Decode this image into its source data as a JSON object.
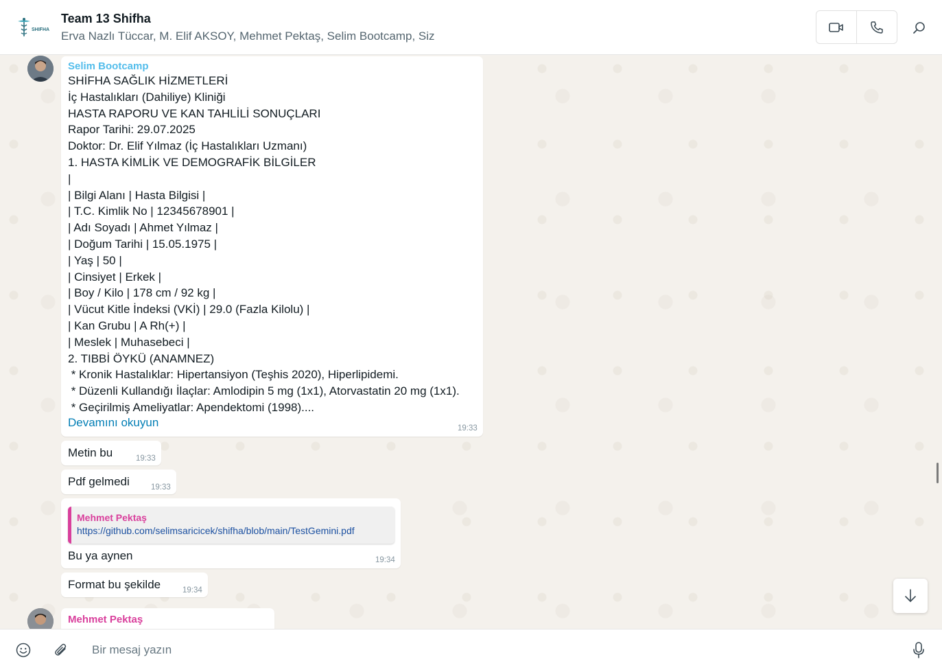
{
  "header": {
    "logo_text": "SHIFHA",
    "title": "Team 13 Shifha",
    "members": "Erva Nazlı Tüccar, M. Elif AKSOY, Mehmet Pektaş, Selim Bootcamp, Siz",
    "icons": [
      "video-call-icon",
      "voice-call-icon",
      "search-icon"
    ]
  },
  "messages": {
    "m1": {
      "sender": "Selim Bootcamp",
      "lines": [
        "SHİFHA SAĞLIK HİZMETLERİ",
        "İç Hastalıkları (Dahiliye) Kliniği",
        "HASTA RAPORU VE KAN TAHLİLİ SONUÇLARI",
        "Rapor Tarihi: 29.07.2025",
        "Doktor: Dr. Elif Yılmaz (İç Hastalıkları Uzmanı)",
        "1. HASTA KİMLİK VE DEMOGRAFİK BİLGİLER",
        "|",
        "| Bilgi Alanı | Hasta Bilgisi |",
        "| T.C. Kimlik No | 12345678901 |",
        "| Adı Soyadı | Ahmet Yılmaz |",
        "| Doğum Tarihi | 15.05.1975 |",
        "| Yaş | 50 |",
        "| Cinsiyet | Erkek |",
        "| Boy / Kilo | 178 cm / 92 kg |",
        "| Vücut Kitle İndeksi (VKİ) | 29.0 (Fazla Kilolu) |",
        "| Kan Grubu | A Rh(+) |",
        "| Meslek | Muhasebeci |",
        "2. TIBBİ ÖYKÜ (ANAMNEZ)",
        " * Kronik Hastalıklar: Hipertansiyon (Teşhis 2020), Hiperlipidemi.",
        " * Düzenli Kullandığı İlaçlar: Amlodipin 5 mg (1x1), Atorvastatin 20 mg (1x1).",
        " * Geçirilmiş Ameliyatlar: Apendektomi (1998)...."
      ],
      "read_more": "Devamını okuyun",
      "time": "19:33"
    },
    "m2": {
      "text": "Metin bu",
      "time": "19:33"
    },
    "m3": {
      "text": "Pdf gelmedi",
      "time": "19:33"
    },
    "m4": {
      "quote_sender": "Mehmet Pektaş",
      "quote_link": "https://github.com/selimsaricicek/shifha/blob/main/TestGemini.pdf",
      "text": "Bu ya aynen",
      "time": "19:34"
    },
    "m5": {
      "text": "Format bu şekilde",
      "time": "19:34"
    },
    "m6": {
      "sender": "Mehmet Pektaş"
    }
  },
  "composer": {
    "placeholder": "Bir mesaj yazın",
    "icons": [
      "emoji-icon",
      "attach-icon",
      "microphone-icon"
    ]
  },
  "colors": {
    "selim_name": "#53bdeb",
    "mehmet_name": "#d93f9c",
    "link": "#027eb5",
    "chat_bg": "#f4f1ec"
  }
}
